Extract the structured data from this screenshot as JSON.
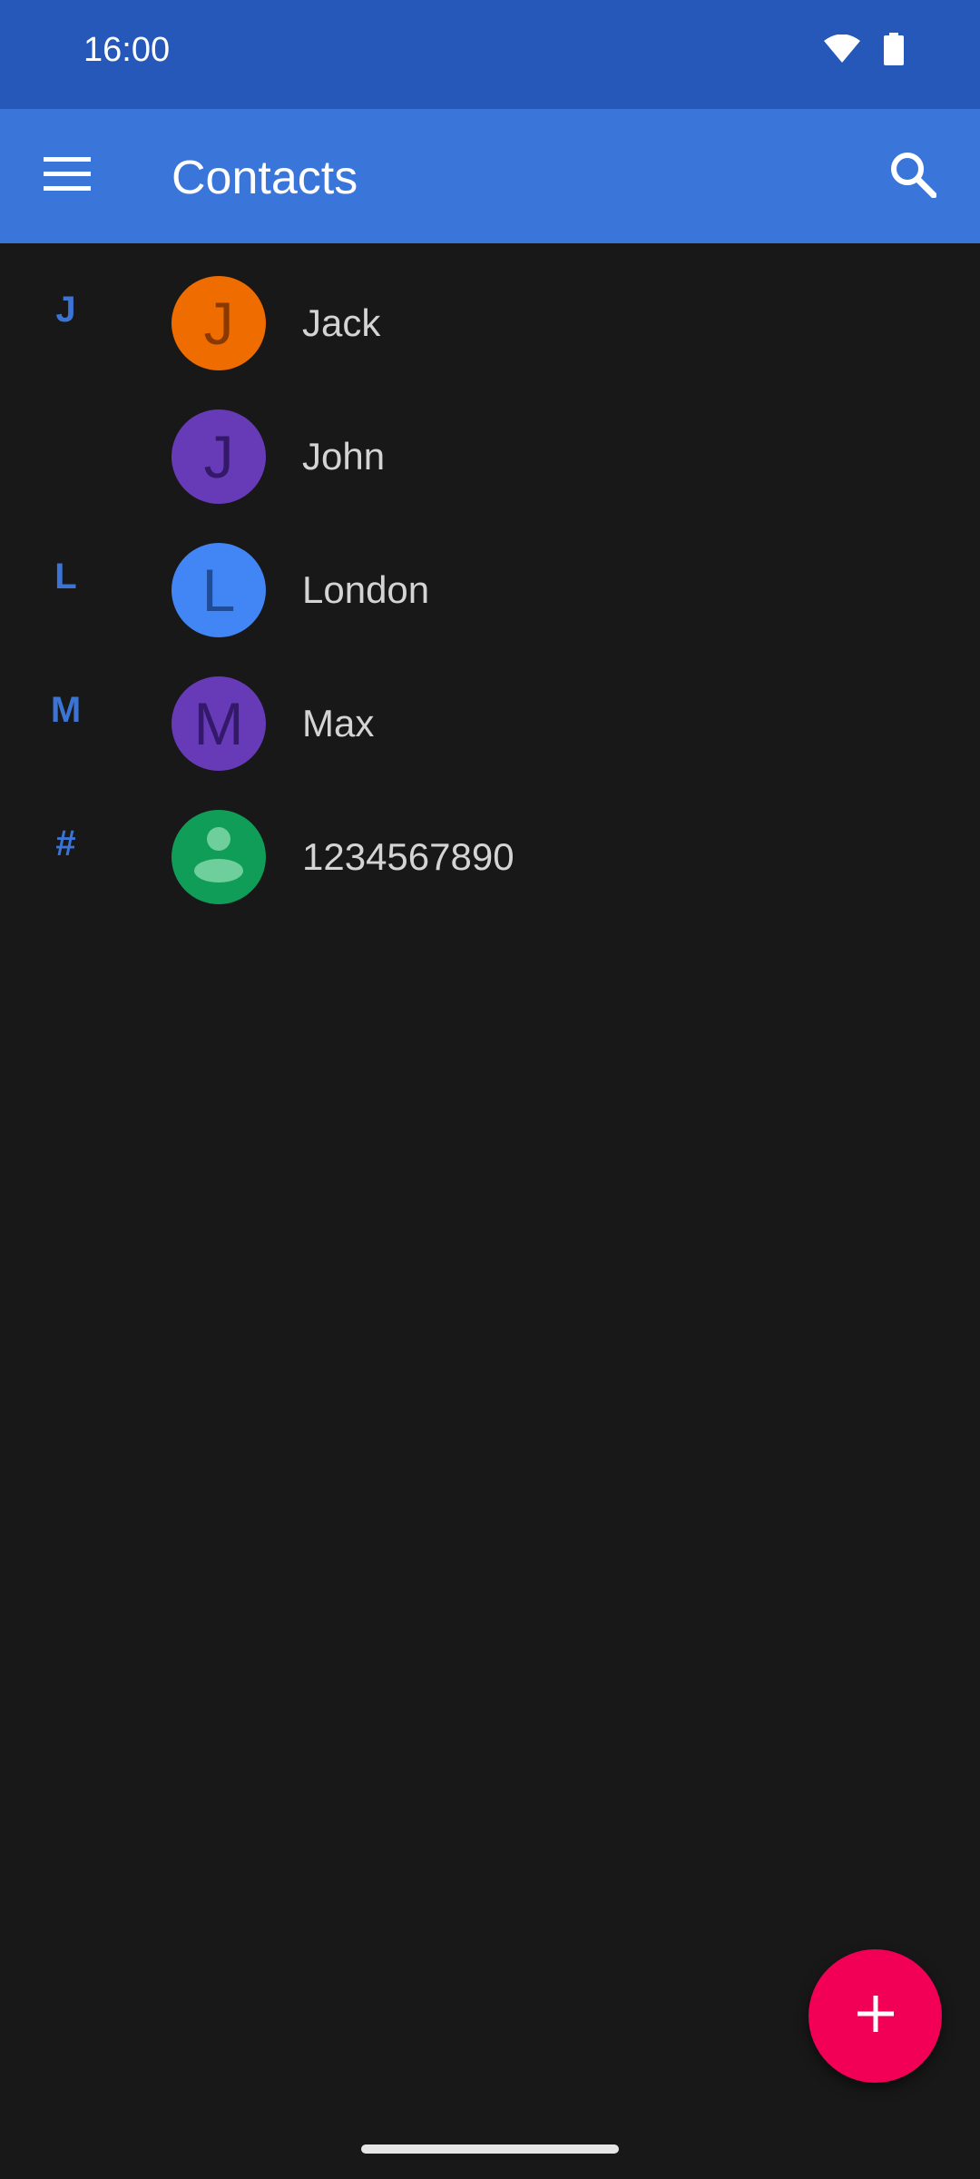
{
  "status_bar": {
    "time": "16:00",
    "icons": [
      "wifi-icon",
      "battery-icon"
    ]
  },
  "app_bar": {
    "title": "Contacts",
    "menu_icon": "menu-icon",
    "search_icon": "search-icon"
  },
  "contacts": [
    {
      "section": "J",
      "name": "Jack",
      "avatar_letter": "J",
      "avatar_color": "#ef6c00",
      "letter_color": "#8a3a00"
    },
    {
      "section": "",
      "name": "John",
      "avatar_letter": "J",
      "avatar_color": "#673ab7",
      "letter_color": "#34196a"
    },
    {
      "section": "L",
      "name": "London",
      "avatar_letter": "L",
      "avatar_color": "#4285f4",
      "letter_color": "#1f4c99"
    },
    {
      "section": "M",
      "name": "Max",
      "avatar_letter": "M",
      "avatar_color": "#673ab7",
      "letter_color": "#34196a"
    },
    {
      "section": "#",
      "name": "1234567890",
      "avatar_letter": "",
      "avatar_icon": "person-icon",
      "avatar_color": "#0f9d58",
      "letter_color": "#6fcf9c"
    }
  ],
  "fab": {
    "icon": "plus-icon",
    "color": "#f10055"
  },
  "colors": {
    "status_bar": "#2658b9",
    "app_bar": "#3a76d9",
    "background": "#181818",
    "section_letter": "#3b74d4"
  }
}
